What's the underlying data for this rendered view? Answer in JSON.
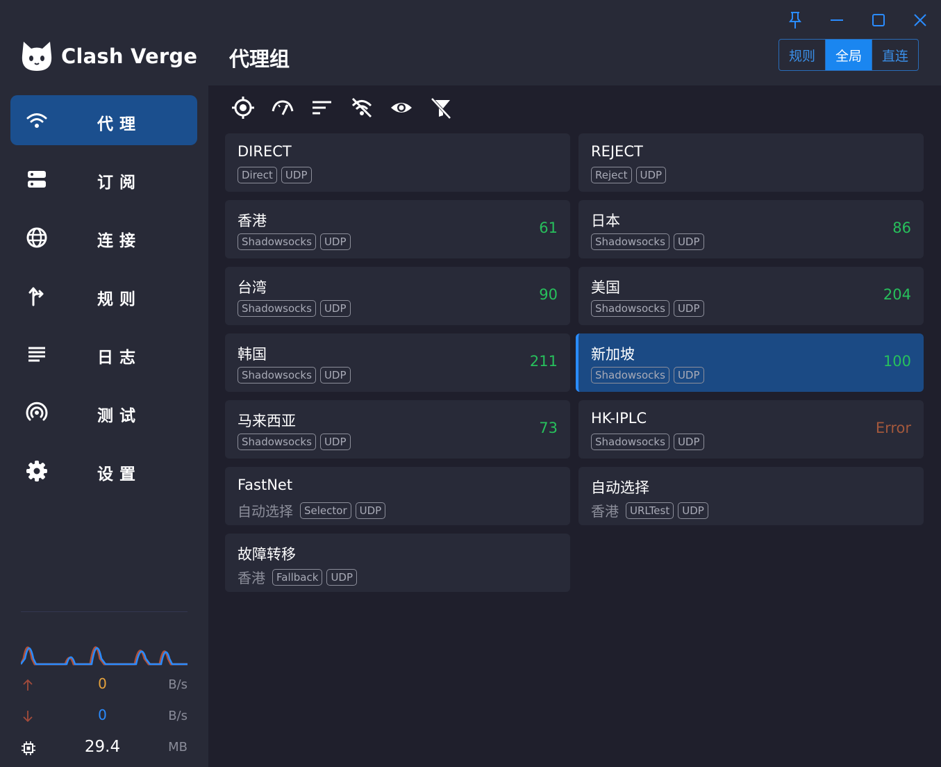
{
  "app": {
    "name": "Clash Verge"
  },
  "page_title": "代理组",
  "nav": [
    {
      "key": "proxy",
      "label": "代理",
      "icon": "wifi-icon",
      "active": true
    },
    {
      "key": "subscription",
      "label": "订阅",
      "icon": "server-icon",
      "active": false
    },
    {
      "key": "connections",
      "label": "连接",
      "icon": "globe-icon",
      "active": false
    },
    {
      "key": "rules",
      "label": "规则",
      "icon": "fork-icon",
      "active": false
    },
    {
      "key": "logs",
      "label": "日志",
      "icon": "list-icon",
      "active": false
    },
    {
      "key": "test",
      "label": "测试",
      "icon": "radar-icon",
      "active": false
    },
    {
      "key": "settings",
      "label": "设置",
      "icon": "gear-icon",
      "active": false
    }
  ],
  "mode_switch": {
    "rule": "规则",
    "global": "全局",
    "direct": "直连",
    "selected": "global"
  },
  "toolbar_icons": [
    "locate-icon",
    "speed-test-icon",
    "sort-icon",
    "hide-unavailable-icon",
    "view-icon",
    "filter-off-icon"
  ],
  "proxies": [
    {
      "name": "DIRECT",
      "tags": [
        "Direct",
        "UDP"
      ],
      "delay": ""
    },
    {
      "name": "REJECT",
      "tags": [
        "Reject",
        "UDP"
      ],
      "delay": ""
    },
    {
      "name": "香港",
      "tags": [
        "Shadowsocks",
        "UDP"
      ],
      "delay": "61"
    },
    {
      "name": "日本",
      "tags": [
        "Shadowsocks",
        "UDP"
      ],
      "delay": "86"
    },
    {
      "name": "台湾",
      "tags": [
        "Shadowsocks",
        "UDP"
      ],
      "delay": "90"
    },
    {
      "name": "美国",
      "tags": [
        "Shadowsocks",
        "UDP"
      ],
      "delay": "204"
    },
    {
      "name": "韩国",
      "tags": [
        "Shadowsocks",
        "UDP"
      ],
      "delay": "211"
    },
    {
      "name": "新加坡",
      "tags": [
        "Shadowsocks",
        "UDP"
      ],
      "delay": "100",
      "selected": true
    },
    {
      "name": "马来西亚",
      "tags": [
        "Shadowsocks",
        "UDP"
      ],
      "delay": "73"
    },
    {
      "name": "HK-IPLC",
      "tags": [
        "Shadowsocks",
        "UDP"
      ],
      "delay": "Error",
      "error": true
    },
    {
      "name": "FastNet",
      "now": "自动选择",
      "tags": [
        "Selector",
        "UDP"
      ],
      "delay": ""
    },
    {
      "name": "自动选择",
      "now": "香港",
      "tags": [
        "URLTest",
        "UDP"
      ],
      "delay": ""
    },
    {
      "name": "故障转移",
      "now": "香港",
      "tags": [
        "Fallback",
        "UDP"
      ],
      "delay": ""
    }
  ],
  "traffic": {
    "upload": {
      "value": "0",
      "unit": "B/s"
    },
    "download": {
      "value": "0",
      "unit": "B/s"
    },
    "memory": {
      "value": "29.4",
      "unit": "MB"
    }
  },
  "colors": {
    "accent": "#1a86f0",
    "delay_ok": "#27c05c",
    "delay_error": "#a3583c",
    "upload_value": "#e6a23c",
    "download_value": "#2a8cff",
    "sidebar_bg": "#282a37",
    "content_bg": "#1f1f2c"
  }
}
